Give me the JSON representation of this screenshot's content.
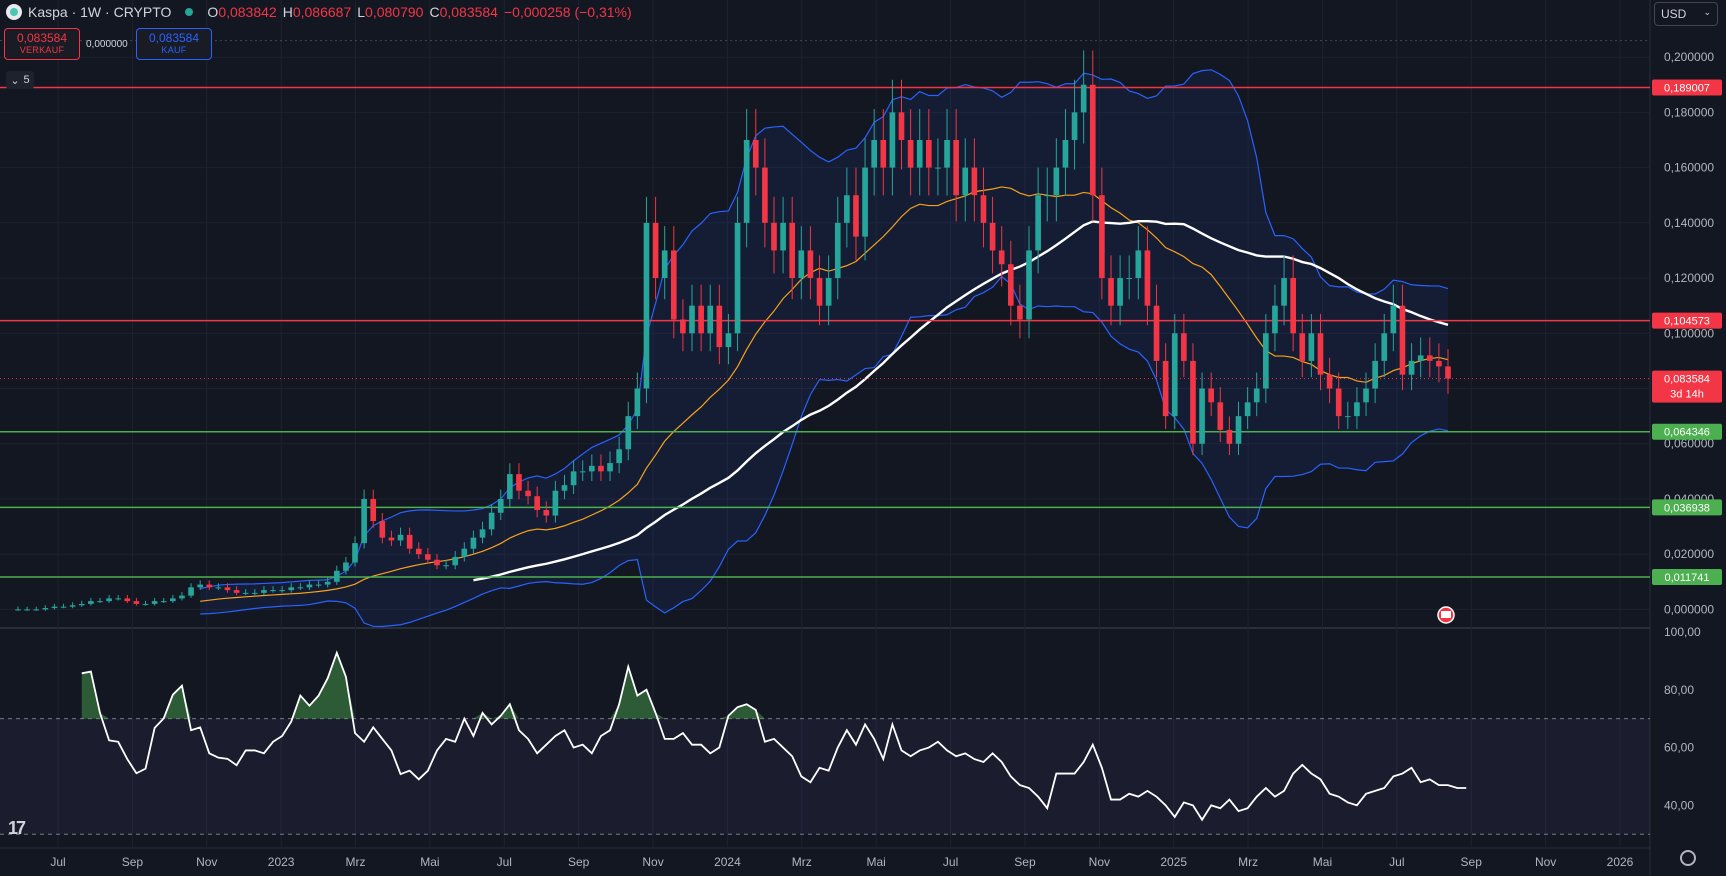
{
  "header": {
    "symbol": "Kaspa · 1W · CRYPTO",
    "o_label": "O",
    "o_value": "0,083842",
    "h_label": "H",
    "h_value": "0,086687",
    "l_label": "L",
    "l_value": "0,080790",
    "c_label": "C",
    "c_value": "0,083584",
    "change": "−0,000258 (−0,31%)"
  },
  "trade": {
    "sell_price": "0,083584",
    "sell_label": "VERKAUF",
    "spread": "0,000000",
    "buy_price": "0,083584",
    "buy_label": "KAUF"
  },
  "indicators_collapsed": "5",
  "currency": "USD",
  "colors": {
    "up": "#26a69a",
    "down": "#f23645",
    "band": "#2962ff",
    "ma_fast": "#f7a21b",
    "ma_slow": "#ffffff",
    "support": "#4caf50",
    "resistance": "#f23645"
  },
  "chart_data": [
    {
      "type": "candlestick",
      "x_tick_labels": [
        "Jul",
        "Sep",
        "Nov",
        "2023",
        "Mrz",
        "Mai",
        "Jul",
        "Sep",
        "Nov",
        "2024",
        "Mrz",
        "Mai",
        "Jul",
        "Sep",
        "Nov",
        "2025",
        "Mrz",
        "Mai",
        "Jul",
        "Sep",
        "Nov",
        "2026"
      ],
      "y_ticks": [
        "0,000000",
        "0,020000",
        "0,040000",
        "0,060000",
        "0,080000",
        "0,100000",
        "0,120000",
        "0,140000",
        "0,160000",
        "0,180000",
        "0,200000"
      ],
      "ylim": [
        -0.006,
        0.212
      ],
      "current_price": 0.083584,
      "countdown": "3d 14h",
      "horizontal_levels": [
        {
          "value": 0.189007,
          "label": "0,189007",
          "kind": "resistance"
        },
        {
          "value": 0.104573,
          "label": "0,104573",
          "kind": "resistance"
        },
        {
          "value": 0.064346,
          "label": "0,064346",
          "kind": "support"
        },
        {
          "value": 0.036938,
          "label": "0,036938",
          "kind": "support"
        },
        {
          "value": 0.011741,
          "label": "0,011741",
          "kind": "support"
        }
      ],
      "current_label": "0,083584",
      "close": [
        0.0,
        0.0,
        0.0,
        0.0005,
        0.001,
        0.001,
        0.0015,
        0.002,
        0.003,
        0.003,
        0.004,
        0.004,
        0.003,
        0.002,
        0.002,
        0.003,
        0.003,
        0.004,
        0.005,
        0.008,
        0.009,
        0.008,
        0.008,
        0.007,
        0.006,
        0.006,
        0.006,
        0.007,
        0.007,
        0.007,
        0.008,
        0.008,
        0.009,
        0.009,
        0.01,
        0.014,
        0.017,
        0.024,
        0.04,
        0.032,
        0.026,
        0.025,
        0.027,
        0.022,
        0.02,
        0.018,
        0.016,
        0.016,
        0.019,
        0.022,
        0.026,
        0.029,
        0.035,
        0.04,
        0.049,
        0.043,
        0.041,
        0.036,
        0.034,
        0.043,
        0.045,
        0.05,
        0.05,
        0.052,
        0.05,
        0.053,
        0.058,
        0.07,
        0.08,
        0.14,
        0.12,
        0.13,
        0.105,
        0.1,
        0.11,
        0.1,
        0.11,
        0.095,
        0.1,
        0.14,
        0.17,
        0.16,
        0.14,
        0.13,
        0.14,
        0.12,
        0.13,
        0.12,
        0.11,
        0.12,
        0.14,
        0.15,
        0.135,
        0.16,
        0.17,
        0.16,
        0.18,
        0.17,
        0.16,
        0.17,
        0.16,
        0.16,
        0.17,
        0.15,
        0.16,
        0.15,
        0.14,
        0.13,
        0.125,
        0.11,
        0.105,
        0.13,
        0.15,
        0.15,
        0.16,
        0.17,
        0.18,
        0.19,
        0.15,
        0.12,
        0.11,
        0.12,
        0.12,
        0.13,
        0.11,
        0.09,
        0.07,
        0.1,
        0.09,
        0.06,
        0.08,
        0.075,
        0.065,
        0.06,
        0.07,
        0.075,
        0.08,
        0.1,
        0.11,
        0.12,
        0.1,
        0.09,
        0.1,
        0.085,
        0.08,
        0.07,
        0.07,
        0.075,
        0.08,
        0.09,
        0.1,
        0.11,
        0.085,
        0.09,
        0.092,
        0.09,
        0.088,
        0.083584
      ]
    },
    {
      "type": "line",
      "series_role": "RSI",
      "y_ticks": [
        "40,00",
        "60,00",
        "80,00",
        "100,00"
      ],
      "ylim": [
        28,
        100
      ],
      "overbought": 70,
      "oversold": 30,
      "values": [
        85.7,
        86.3,
        72.0,
        62.5,
        62.0,
        56.0,
        51.1,
        52.7,
        66.8,
        70.1,
        78.3,
        81.4,
        66.0,
        67.0,
        58.0,
        56.5,
        56.1,
        53.9,
        59.0,
        59.0,
        58.0,
        62.0,
        64.0,
        69.0,
        78.0,
        74.5,
        78.0,
        84.0,
        92.8,
        84.5,
        65.0,
        62.0,
        67.0,
        63.0,
        59.0,
        50.8,
        52.0,
        49.0,
        52.0,
        59.0,
        63.0,
        62.0,
        70.0,
        64.0,
        72.0,
        68.0,
        71.0,
        75.0,
        66.0,
        63.0,
        58.0,
        61.0,
        64.0,
        66.0,
        60.0,
        61.0,
        58.0,
        64.0,
        66.0,
        75.0,
        88.0,
        78.0,
        80.0,
        72.0,
        63.0,
        63.0,
        65.0,
        61.0,
        61.0,
        58.0,
        60.0,
        71.0,
        74.0,
        75.0,
        73.0,
        62.0,
        63.0,
        60.0,
        57.0,
        50.0,
        48.0,
        53.0,
        52.0,
        60.0,
        66.0,
        61.0,
        68.0,
        63.0,
        56.0,
        68.0,
        59.0,
        57.0,
        59.0,
        60.0,
        62.0,
        59.0,
        57.0,
        58.0,
        56.0,
        55.0,
        58.0,
        55.0,
        50.0,
        47.0,
        46.0,
        43.0,
        39.0,
        51.0,
        51.0,
        51.0,
        55.0,
        61.0,
        53.0,
        42.0,
        42.0,
        44.0,
        43.0,
        45.0,
        43.0,
        40.0,
        36.0,
        41.0,
        40.0,
        35.0,
        40.0,
        39.0,
        42.0,
        38.0,
        39.0,
        43.0,
        46.0,
        43.0,
        45.0,
        51.0,
        54.0,
        51.0,
        49.0,
        44.0,
        43.0,
        41.0,
        40.0,
        44.0,
        45.0,
        46.0,
        50.0,
        51.0,
        53.0,
        48.0,
        49.0,
        47.0,
        47.0,
        46.0,
        46.0
      ]
    }
  ]
}
